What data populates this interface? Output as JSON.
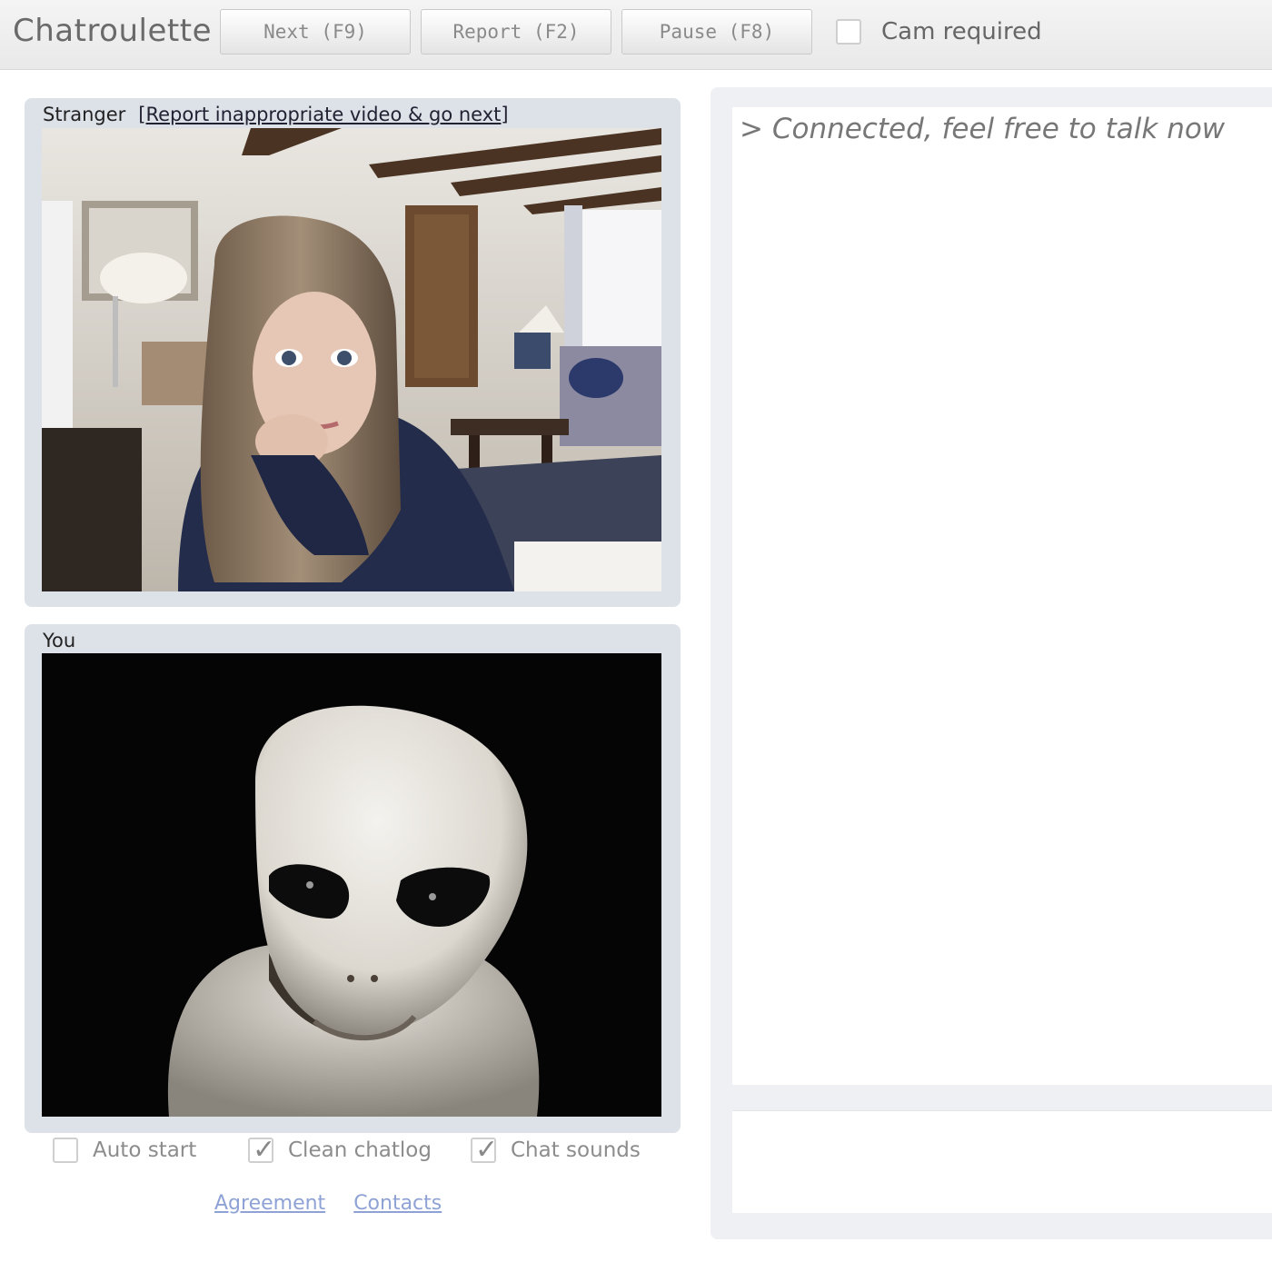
{
  "app": {
    "title": "Chatroulette"
  },
  "toolbar": {
    "next_label": "Next (F9)",
    "report_label": "Report (F2)",
    "pause_label": "Pause (F8)",
    "cam_required_label": "Cam required",
    "cam_required_checked": false
  },
  "stranger": {
    "label": "Stranger",
    "report_link": "[Report inappropriate video & go next]",
    "video_icon": "webcam-feed"
  },
  "you": {
    "label": "You",
    "video_icon": "webcam-feed"
  },
  "options": {
    "auto_start": {
      "label": "Auto start",
      "checked": false
    },
    "clean_chatlog": {
      "label": "Clean chatlog",
      "checked": true
    },
    "chat_sounds": {
      "label": "Chat sounds",
      "checked": true
    }
  },
  "footer": {
    "agreement": "Agreement",
    "contacts": "Contacts"
  },
  "chat": {
    "messages": [
      "> Connected, feel free to talk now"
    ],
    "input_value": ""
  },
  "colors": {
    "panel_bg": "#dde1e8",
    "link": "#8ea2d6"
  }
}
